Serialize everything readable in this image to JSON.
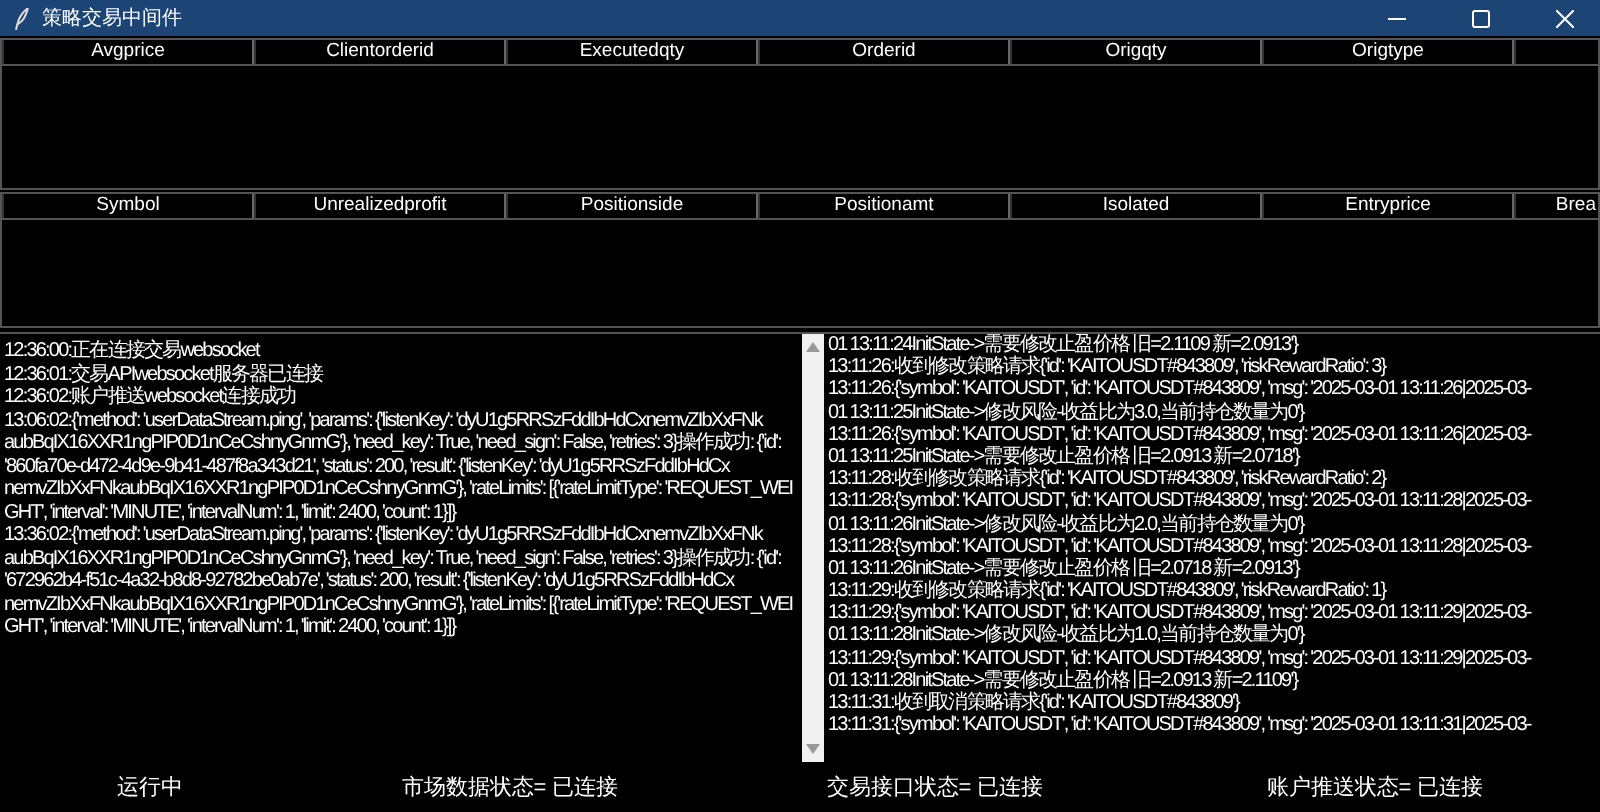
{
  "window": {
    "title": "策略交易中间件"
  },
  "orders_table": {
    "columns": [
      "Avgprice",
      "Clientorderid",
      "Executedqty",
      "Orderid",
      "Origqty",
      "Origtype",
      ""
    ]
  },
  "positions_table": {
    "columns": [
      "Symbol",
      "Unrealizedprofit",
      "Positionside",
      "Positionamt",
      "Isolated",
      "Entryprice",
      "Brea"
    ]
  },
  "system_log": [
    "12:36:00:正在连接交易websocket",
    "12:36:01:交易APIwebsocket服务器已连接",
    "12:36:02:账户推送websocket连接成功",
    "13:06:02:{'method': 'userDataStream.ping', 'params': {'listenKey': 'dyU1g5RRSzFddIbHdCxnemvZIbXxFNk",
    "aubBqIX16XXR1ngPIP0D1nCeCshnyGnmG'}, 'need_key': True, 'need_sign': False, 'retries': 3}操作成功: {'id':",
    "'860fa70e-d472-4d9e-9b41-487f8a343d21', 'status': 200, 'result': {'listenKey': 'dyU1g5RRSzFddIbHdCx",
    "nemvZIbXxFNkaubBqIX16XXR1ngPIP0D1nCeCshnyGnmG'}, 'rateLimits': [{'rateLimitType': 'REQUEST_WEI",
    "GHT', 'interval': 'MINUTE', 'intervalNum': 1, 'limit': 2400, 'count': 1}]}",
    "13:36:02:{'method': 'userDataStream.ping', 'params': {'listenKey': 'dyU1g5RRSzFddIbHdCxnemvZIbXxFNk",
    "aubBqIX16XXR1ngPIP0D1nCeCshnyGnmG'}, 'need_key': True, 'need_sign': False, 'retries': 3}操作成功: {'id':",
    "'672962b4-f51c-4a32-b8d8-92782be0ab7e', 'status': 200, 'result': {'listenKey': 'dyU1g5RRSzFddIbHdCx",
    "nemvZIbXxFNkaubBqIX16XXR1ngPIP0D1nCeCshnyGnmG'}, 'rateLimits': [{'rateLimitType': 'REQUEST_WEI",
    "GHT', 'interval': 'MINUTE', 'intervalNum': 1, 'limit': 2400, 'count': 1}]}"
  ],
  "strategy_log": [
    "01 13:11:24InitState->需要修改止盈价格 旧=2.1109 新=2.0913'}",
    "13:11:26:收到修改策略请求{'id': 'KAITOUSDT#843809', 'riskRewardRatio': 3}",
    "13:11:26:{'symbol': 'KAITOUSDT', 'id': 'KAITOUSDT#843809', 'msg': '2025-03-01 13:11:26|2025-03-",
    "01 13:11:25InitState->修改风险-收益比为3.0,当前持仓数量为0'}",
    "13:11:26:{'symbol': 'KAITOUSDT', 'id': 'KAITOUSDT#843809', 'msg': '2025-03-01 13:11:26|2025-03-",
    "01 13:11:25InitState->需要修改止盈价格 旧=2.0913 新=2.0718'}",
    "13:11:28:收到修改策略请求{'id': 'KAITOUSDT#843809', 'riskRewardRatio': 2}",
    "13:11:28:{'symbol': 'KAITOUSDT', 'id': 'KAITOUSDT#843809', 'msg': '2025-03-01 13:11:28|2025-03-",
    "01 13:11:26InitState->修改风险-收益比为2.0,当前持仓数量为0'}",
    "13:11:28:{'symbol': 'KAITOUSDT', 'id': 'KAITOUSDT#843809', 'msg': '2025-03-01 13:11:28|2025-03-",
    "01 13:11:26InitState->需要修改止盈价格 旧=2.0718 新=2.0913'}",
    "13:11:29:收到修改策略请求{'id': 'KAITOUSDT#843809', 'riskRewardRatio': 1}",
    "13:11:29:{'symbol': 'KAITOUSDT', 'id': 'KAITOUSDT#843809', 'msg': '2025-03-01 13:11:29|2025-03-",
    "01 13:11:28InitState->修改风险-收益比为1.0,当前持仓数量为0'}",
    "13:11:29:{'symbol': 'KAITOUSDT', 'id': 'KAITOUSDT#843809', 'msg': '2025-03-01 13:11:29|2025-03-",
    "01 13:11:28InitState->需要修改止盈价格 旧=2.0913 新=2.1109'}",
    "13:11:31:收到取消策略请求{'id': 'KAITOUSDT#843809'}",
    "13:11:31:{'symbol': 'KAITOUSDT', 'id': 'KAITOUSDT#843809', 'msg': '2025-03-01 13:11:31|2025-03-"
  ],
  "status_bar": [
    "运行中",
    "市场数据状态= 已连接",
    "交易接口状态= 已连接",
    "账户推送状态= 已连接"
  ]
}
